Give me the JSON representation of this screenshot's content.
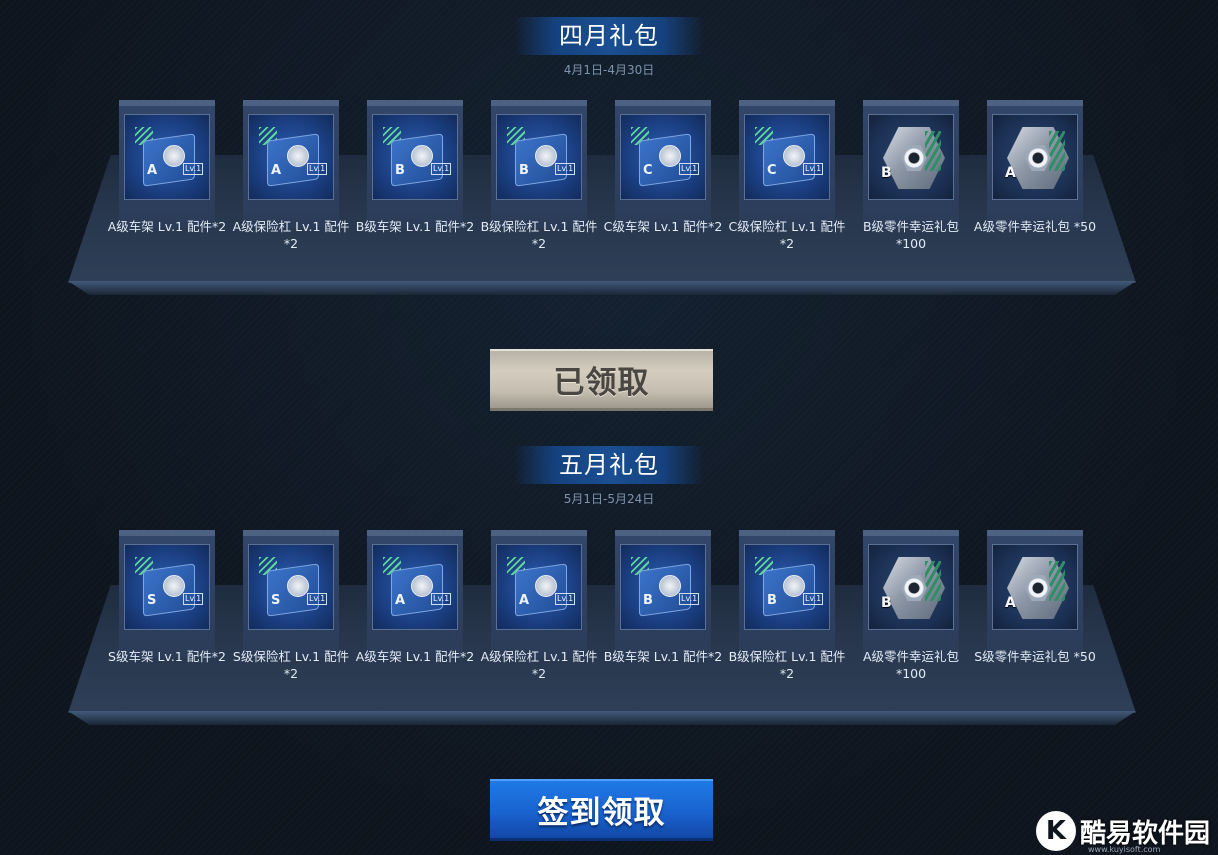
{
  "sections": [
    {
      "title": "四月礼包",
      "date": "4月1日-4月30日",
      "items": [
        {
          "label": "A级车架 Lv.1 配件*2",
          "kind": "frame",
          "grade": "A",
          "icon": "frame-part-icon"
        },
        {
          "label": "A级保险杠 Lv.1 配件*2",
          "kind": "bumper",
          "grade": "A",
          "icon": "bumper-part-icon"
        },
        {
          "label": "B级车架 Lv.1 配件*2",
          "kind": "frame",
          "grade": "B",
          "icon": "frame-part-icon"
        },
        {
          "label": "B级保险杠 Lv.1 配件*2",
          "kind": "bumper",
          "grade": "B",
          "icon": "bumper-part-icon"
        },
        {
          "label": "C级车架 Lv.1 配件*2",
          "kind": "frame",
          "grade": "C",
          "icon": "frame-part-icon"
        },
        {
          "label": "C级保险杠 Lv.1 配件*2",
          "kind": "bumper",
          "grade": "C",
          "icon": "bumper-part-icon"
        },
        {
          "label": "B级零件幸运礼包 *100",
          "kind": "lucky",
          "grade": "B",
          "icon": "nut-hex-icon"
        },
        {
          "label": "A级零件幸运礼包 *50",
          "kind": "lucky",
          "grade": "A",
          "icon": "nut-hex-icon"
        }
      ],
      "button": {
        "label": "已领取",
        "state": "claimed",
        "color": "#c6bfb1"
      }
    },
    {
      "title": "五月礼包",
      "date": "5月1日-5月24日",
      "items": [
        {
          "label": "S级车架 Lv.1 配件*2",
          "kind": "frame",
          "grade": "S",
          "icon": "frame-part-icon"
        },
        {
          "label": "S级保险杠 Lv.1 配件*2",
          "kind": "bumper",
          "grade": "S",
          "icon": "bumper-part-icon"
        },
        {
          "label": "A级车架 Lv.1 配件*2",
          "kind": "frame",
          "grade": "A",
          "icon": "frame-part-icon"
        },
        {
          "label": "A级保险杠 Lv.1 配件*2",
          "kind": "bumper",
          "grade": "A",
          "icon": "bumper-part-icon"
        },
        {
          "label": "B级车架 Lv.1 配件*2",
          "kind": "frame",
          "grade": "B",
          "icon": "frame-part-icon"
        },
        {
          "label": "B级保险杠 Lv.1 配件*2",
          "kind": "bumper",
          "grade": "B",
          "icon": "bumper-part-icon"
        },
        {
          "label": "A级零件幸运礼包 *100",
          "kind": "lucky",
          "grade": "B",
          "icon": "nut-hex-icon"
        },
        {
          "label": "S级零件幸运礼包 *50",
          "kind": "lucky",
          "grade": "A",
          "icon": "nut-hex-icon"
        }
      ],
      "button": {
        "label": "签到领取",
        "state": "available",
        "color": "#1a63d0"
      }
    }
  ],
  "lv_tag": "Lv.1",
  "watermark": {
    "logo": "K",
    "text": "酷易软件园",
    "url": "www.kuyisoft.com"
  }
}
